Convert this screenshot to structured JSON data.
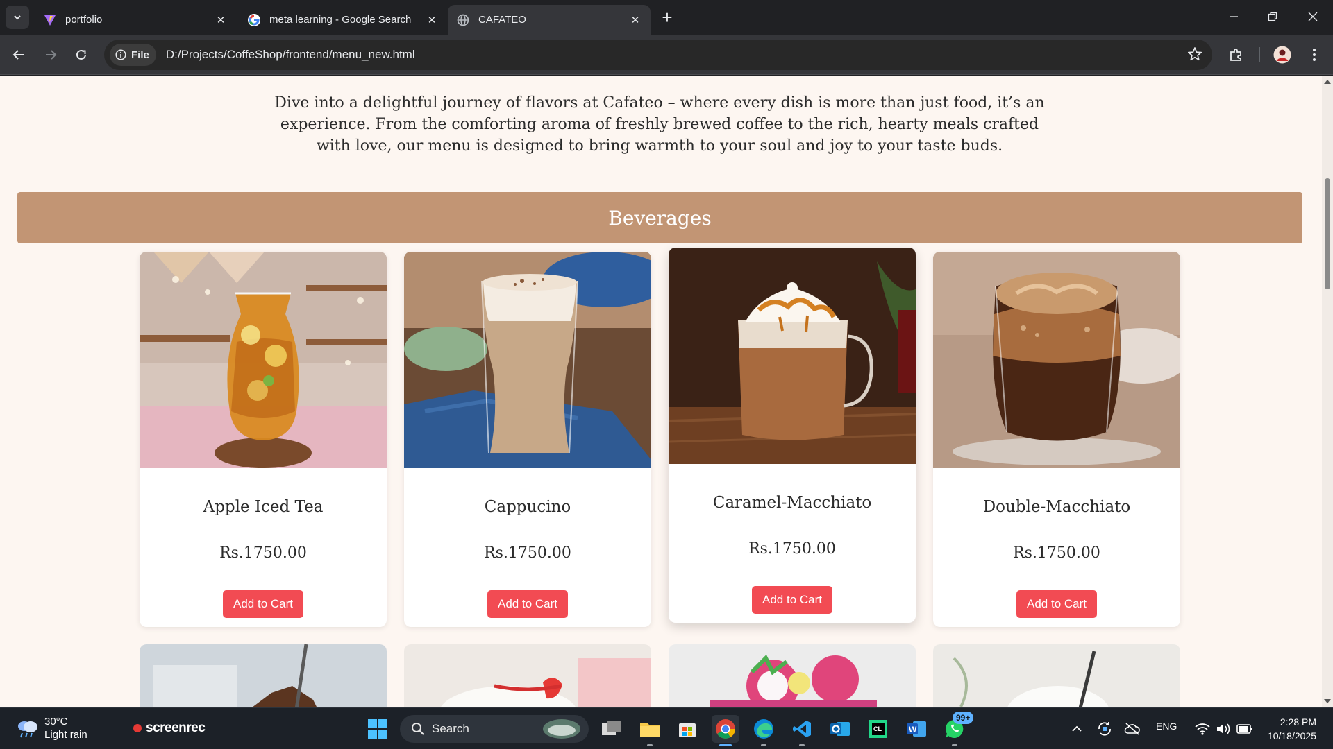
{
  "browser": {
    "tabs": [
      {
        "title": "portfolio",
        "icon": "vite-icon"
      },
      {
        "title": "meta learning - Google Search",
        "icon": "google-icon"
      },
      {
        "title": "CAFATEO",
        "icon": "globe-icon",
        "active": true
      }
    ],
    "address": {
      "chip_label": "File",
      "url": "D:/Projects/CoffeShop/frontend/menu_new.html"
    }
  },
  "page": {
    "intro": "Dive into a delightful journey of flavors at Cafateo – where every dish is more than just food, it’s an experience. From the comforting aroma of freshly brewed coffee to the rich, hearty meals crafted with love, our menu is designed to bring warmth to your soul and joy to your taste buds.",
    "section_title": "Beverages",
    "items": [
      {
        "name": "Apple Iced Tea",
        "price": "Rs.1750.00",
        "button": "Add to Cart"
      },
      {
        "name": "Cappucino",
        "price": "Rs.1750.00",
        "button": "Add to Cart"
      },
      {
        "name": "Caramel-Macchiato",
        "price": "Rs.1750.00",
        "button": "Add to Cart"
      },
      {
        "name": "Double-Macchiato",
        "price": "Rs.1750.00",
        "button": "Add to Cart"
      }
    ]
  },
  "taskbar": {
    "weather_temp": "30°C",
    "weather_desc": "Light rain",
    "screenrec_label": "screenrec",
    "search_label": "Search",
    "whatsapp_badge": "99+",
    "language": "ENG",
    "time": "2:28 PM",
    "date": "10/18/2025"
  },
  "colors": {
    "banner": "#c29574",
    "add_button": "#f24b53",
    "page_bg": "#fdf6f1"
  }
}
